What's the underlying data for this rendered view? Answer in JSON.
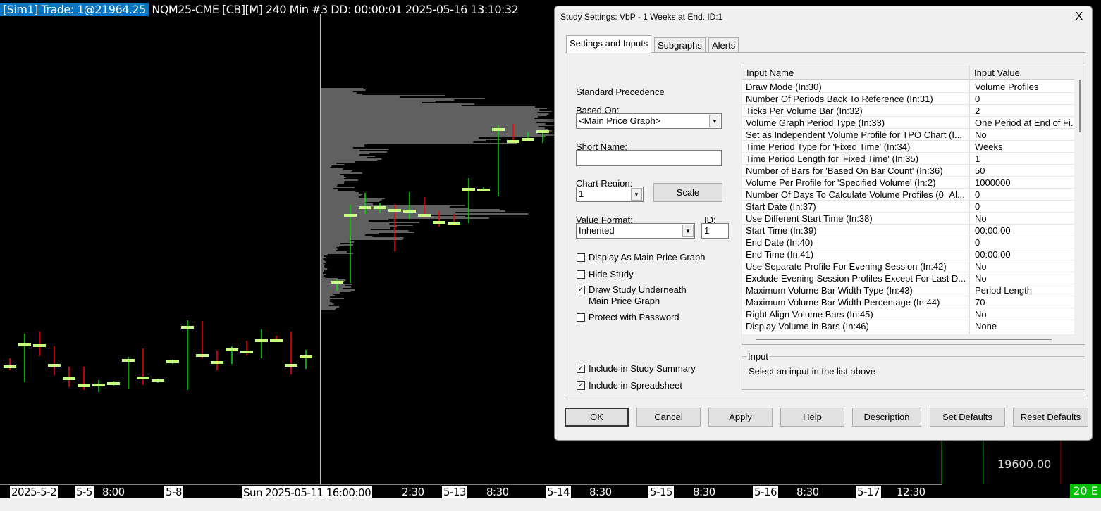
{
  "chart": {
    "header_selected": "[Sim1]  Trade: 1@21964.25",
    "header_rest": "NQM25-CME [CB][M]  240 Min  #3 DD: 00:00:01 2025-05-16 13:10:32",
    "price_label": "19600.00",
    "corner_badge": "20 E",
    "x_labels": [
      "2025-5-2",
      "5-5",
      "8:00",
      "5-8",
      "2:30",
      "5-13",
      "8:30",
      "5-14",
      "8:30",
      "5-15",
      "8:30",
      "5-16",
      "8:30",
      "5-17",
      "12:30"
    ],
    "cursor_label": "Sun 2025-05-11  16:00:00",
    "colors": {
      "up": "#00e000",
      "down": "#ff0000",
      "tick": "#c8ff80",
      "profile": "#606060",
      "selection": "#0a74c0"
    }
  },
  "dialog": {
    "title": "Study Settings: VbP - 1 Weeks at End. ID:1",
    "close": "X",
    "tabs": [
      "Settings and Inputs",
      "Subgraphs",
      "Alerts"
    ],
    "standard_precedence": "Standard Precedence",
    "based_on_label": "Based On:",
    "based_on_value": "<Main Price Graph>",
    "short_name_label": "Short Name:",
    "short_name_value": "",
    "chart_region_label": "Chart Region:",
    "chart_region_value": "1",
    "scale": "Scale",
    "value_format_label": "Value Format:",
    "value_format_value": "Inherited",
    "id_label": "ID:",
    "id_value": "1",
    "checkboxes": [
      {
        "label": "Display As Main Price Graph",
        "checked": false
      },
      {
        "label": "Hide Study",
        "checked": false
      },
      {
        "label": "Draw Study Underneath",
        "label2": "Main Price Graph",
        "checked": true
      },
      {
        "label": "Protect with Password",
        "checked": false
      },
      {
        "label": "Include in Study Summary",
        "checked": true
      },
      {
        "label": "Include in Spreadsheet",
        "checked": true
      }
    ],
    "columns": [
      "Input Name",
      "Input Value"
    ],
    "inputs": [
      {
        "name": "Draw Mode   (In:30)",
        "value": "Volume Profiles"
      },
      {
        "name": "Number Of Periods Back To Reference   (In:31)",
        "value": "0"
      },
      {
        "name": "Ticks Per Volume Bar   (In:32)",
        "value": "2"
      },
      {
        "name": "Volume Graph Period Type   (In:33)",
        "value": "One Period at End of Fi..."
      },
      {
        "name": "Set as Independent Volume Profile for TPO Chart   (I...",
        "value": "No"
      },
      {
        "name": "Time Period Type for 'Fixed Time'   (In:34)",
        "value": "Weeks"
      },
      {
        "name": "Time Period Length for 'Fixed Time'   (In:35)",
        "value": "1"
      },
      {
        "name": "Number of Bars for 'Based On Bar Count'   (In:36)",
        "value": "50"
      },
      {
        "name": "Volume Per Profile for 'Specified Volume'   (In:2)",
        "value": "1000000"
      },
      {
        "name": "Number Of Days To Calculate Volume Profiles (0=Al...",
        "value": "0"
      },
      {
        "name": "Start Date   (In:37)",
        "value": "0"
      },
      {
        "name": "Use Different Start Time   (In:38)",
        "value": "No"
      },
      {
        "name": "Start Time   (In:39)",
        "value": "00:00:00"
      },
      {
        "name": "End Date   (In:40)",
        "value": "0"
      },
      {
        "name": "End Time   (In:41)",
        "value": "00:00:00"
      },
      {
        "name": "Use Separate Profile For Evening Session   (In:42)",
        "value": "No"
      },
      {
        "name": "Exclude Evening Session Profiles Except For Last D...",
        "value": "No"
      },
      {
        "name": "Maximum Volume Bar Width Type   (In:43)",
        "value": "Period Length"
      },
      {
        "name": "Maximum Volume Bar Width Percentage   (In:44)",
        "value": "70"
      },
      {
        "name": "Right Align Volume Bars   (In:45)",
        "value": "No"
      },
      {
        "name": "Display Volume in Bars   (In:46)",
        "value": "None"
      }
    ],
    "input_group_label": "Input",
    "input_group_text": "Select an input in the list above",
    "buttons": [
      "OK",
      "Cancel",
      "Apply",
      "Help",
      "Description",
      "Set Defaults",
      "Reset Defaults"
    ]
  }
}
